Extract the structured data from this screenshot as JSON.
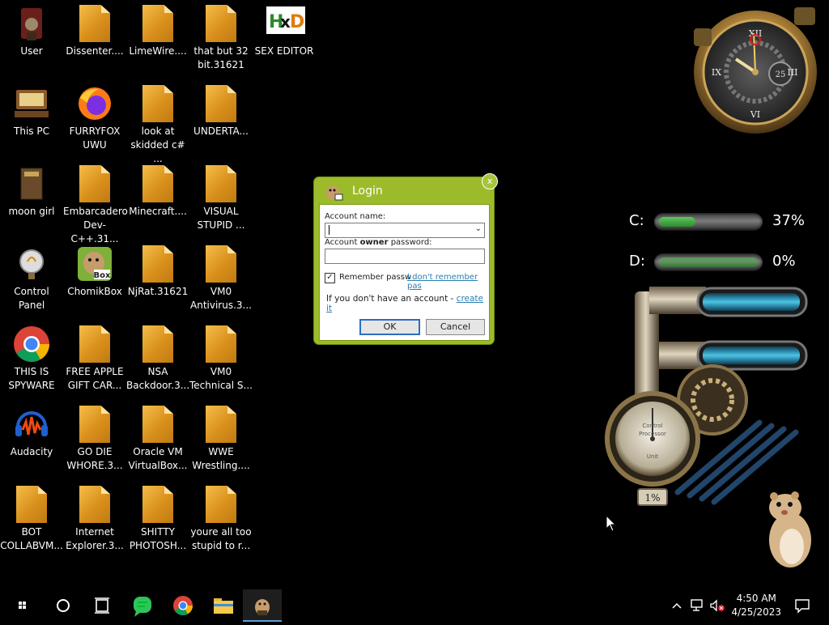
{
  "desktop_icons": [
    {
      "label": "User",
      "icon": "user-folder-icon"
    },
    {
      "label": "Dissenter....",
      "icon": "file-icon"
    },
    {
      "label": "LimeWire....",
      "icon": "file-icon"
    },
    {
      "label": "that but 32 bit.31621",
      "icon": "file-icon"
    },
    {
      "label": "SEX EDITOR",
      "icon": "hxd-icon"
    },
    {
      "label": "This PC",
      "icon": "computer-icon"
    },
    {
      "label": "FURRYFOX UWU",
      "icon": "firefox-icon"
    },
    {
      "label": "look at skidded c# ...",
      "icon": "file-icon"
    },
    {
      "label": "UNDERTA...",
      "icon": "file-icon"
    },
    {
      "label": "moon girl",
      "icon": "book-icon"
    },
    {
      "label": "Embarcadero Dev-C++.31...",
      "icon": "file-icon"
    },
    {
      "label": "Minecraft....",
      "icon": "file-icon"
    },
    {
      "label": "VISUAL STUPID ...",
      "icon": "file-icon"
    },
    {
      "label": "Control Panel",
      "icon": "control-panel-icon"
    },
    {
      "label": "ChomikBox",
      "icon": "chomikbox-icon"
    },
    {
      "label": "NjRat.31621",
      "icon": "file-icon"
    },
    {
      "label": "VM0 Antivirus.3...",
      "icon": "file-icon"
    },
    {
      "label": "THIS IS SPYWARE",
      "icon": "chrome-icon"
    },
    {
      "label": "FREE APPLE GIFT CAR...",
      "icon": "file-icon"
    },
    {
      "label": "NSA Backdoor.3...",
      "icon": "file-icon"
    },
    {
      "label": "VM0 Technical S...",
      "icon": "file-icon"
    },
    {
      "label": "Audacity",
      "icon": "audacity-icon"
    },
    {
      "label": "GO DIE WHORE.3...",
      "icon": "file-icon"
    },
    {
      "label": "Oracle VM VirtualBox...",
      "icon": "file-icon"
    },
    {
      "label": "WWE Wrestling....",
      "icon": "file-icon"
    },
    {
      "label": "BOT COLLABVM...",
      "icon": "file-icon"
    },
    {
      "label": "Internet Explorer.3...",
      "icon": "file-icon"
    },
    {
      "label": "SHITTY PHOTOSH...",
      "icon": "file-icon"
    },
    {
      "label": "youre all too stupid to r...",
      "icon": "file-icon"
    }
  ],
  "login": {
    "title": "Login",
    "close_glyph": "x",
    "account_name_label": "Account name:",
    "account_name_value": "",
    "password_label_pre": "Account ",
    "password_label_bold": "owner",
    "password_label_post": " password:",
    "password_value": "",
    "remember_label": "Remember passw",
    "remember_checked": true,
    "forgot_link": "I don't remember pas",
    "no_account_text": "If you don't have an account - ",
    "create_link": "create it",
    "ok_label": "OK",
    "cancel_label": "Cancel"
  },
  "clock_gadget": {
    "date_number": "25"
  },
  "drive_gadget": {
    "drives": [
      {
        "label": "C:",
        "percent_text": "37%",
        "fill_fraction": 0.37
      },
      {
        "label": "D:",
        "percent_text": "0%",
        "fill_fraction": 0.0
      }
    ]
  },
  "cpu_gadget": {
    "gauge_label_1": "Control",
    "gauge_label_2": "Processor",
    "gauge_unit": "Unit",
    "percent_text": "1%"
  },
  "taskbar": {
    "pinned": [
      "start-icon",
      "search-icon",
      "task-view-icon",
      "chat-app-icon",
      "chrome-icon",
      "file-explorer-icon",
      "chomikbox-icon"
    ],
    "active_index": 6,
    "time": "4:50 AM",
    "date": "4/25/2023"
  },
  "colors": {
    "dialog_green": "#9cbb2a",
    "link_blue": "#2a7fb0",
    "file_orange": "#e3a02e"
  }
}
